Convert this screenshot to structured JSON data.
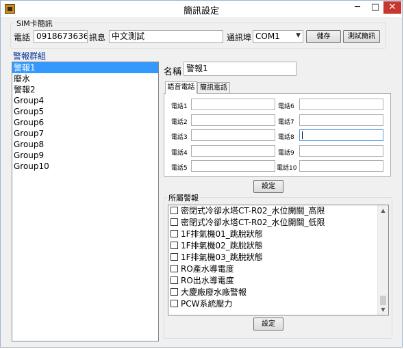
{
  "window": {
    "title": "簡訊設定",
    "minimize_glyph": "─",
    "maximize_glyph": "□",
    "close_glyph": "✕",
    "icon": "app-icon"
  },
  "sim_group": {
    "label": "SIM卡簡訊",
    "phone_label": "電話",
    "phone_value": "0918673636",
    "message_label": "訊息",
    "message_value": "中文測試",
    "port_label": "通訊埠",
    "port_value": "COM1",
    "save_label": "儲存",
    "test_label": "測試簡訊"
  },
  "alarm_group": {
    "label": "警報群組",
    "items": [
      "警報1",
      "廢水",
      "警報2",
      "Group4",
      "Group5",
      "Group6",
      "Group7",
      "Group8",
      "Group9",
      "Group10"
    ],
    "selected_index": 0
  },
  "name": {
    "label": "名稱",
    "value": "警報1"
  },
  "tabs": {
    "voice": "語音電話",
    "sms": "簡訊電話"
  },
  "phones": {
    "labels": [
      "電話1",
      "電話2",
      "電話3",
      "電話4",
      "電話5",
      "電話6",
      "電話7",
      "電話8",
      "電話9",
      "電話10"
    ],
    "values": [
      "",
      "",
      "",
      "",
      "",
      "",
      "",
      "",
      "",
      ""
    ]
  },
  "set_button_1": "設定",
  "belonging": {
    "label": "所屬警報",
    "items": [
      "密閉式冷卻水塔CT-R02_水位開關_高限",
      "密閉式冷卻水塔CT-R02_水位開關_低限",
      "1F排氣機01_跳脫狀態",
      "1F排氣機02_跳脫狀態",
      "1F排氣機03_跳脫狀態",
      "RO產水導電度",
      "RO出水導電度",
      "大慶廠廢水廠警報",
      "PCW系統壓力"
    ],
    "checked": [
      false,
      false,
      false,
      false,
      false,
      false,
      false,
      false,
      false
    ]
  },
  "set_button_2": "設定",
  "colors": {
    "selection": "#3399ff",
    "close_button": "#c7372f",
    "group_title": "#003399"
  }
}
